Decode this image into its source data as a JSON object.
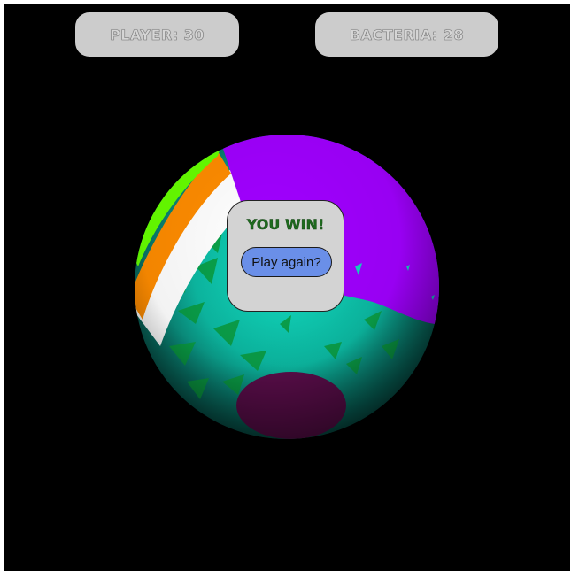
{
  "hud": {
    "player_label": "PLAYER: 30",
    "bacteria_label": "BACTERIA: 28"
  },
  "dialog": {
    "title": "YOU WIN!",
    "play_again_label": "Play again?"
  },
  "colors": {
    "background": "#000000",
    "hud_box": "#cccccc",
    "dialog_bg": "#d3d3d3",
    "title_green": "#1e6b1e",
    "button_blue": "#6a8fe8",
    "sphere_teal": "#0fb8a4",
    "sphere_purple": "#a000ff",
    "sphere_orange": "#ff8c00",
    "sphere_lime": "#66ff00",
    "sphere_white": "#ffffff",
    "spot_magenta": "#5a0d4a"
  }
}
